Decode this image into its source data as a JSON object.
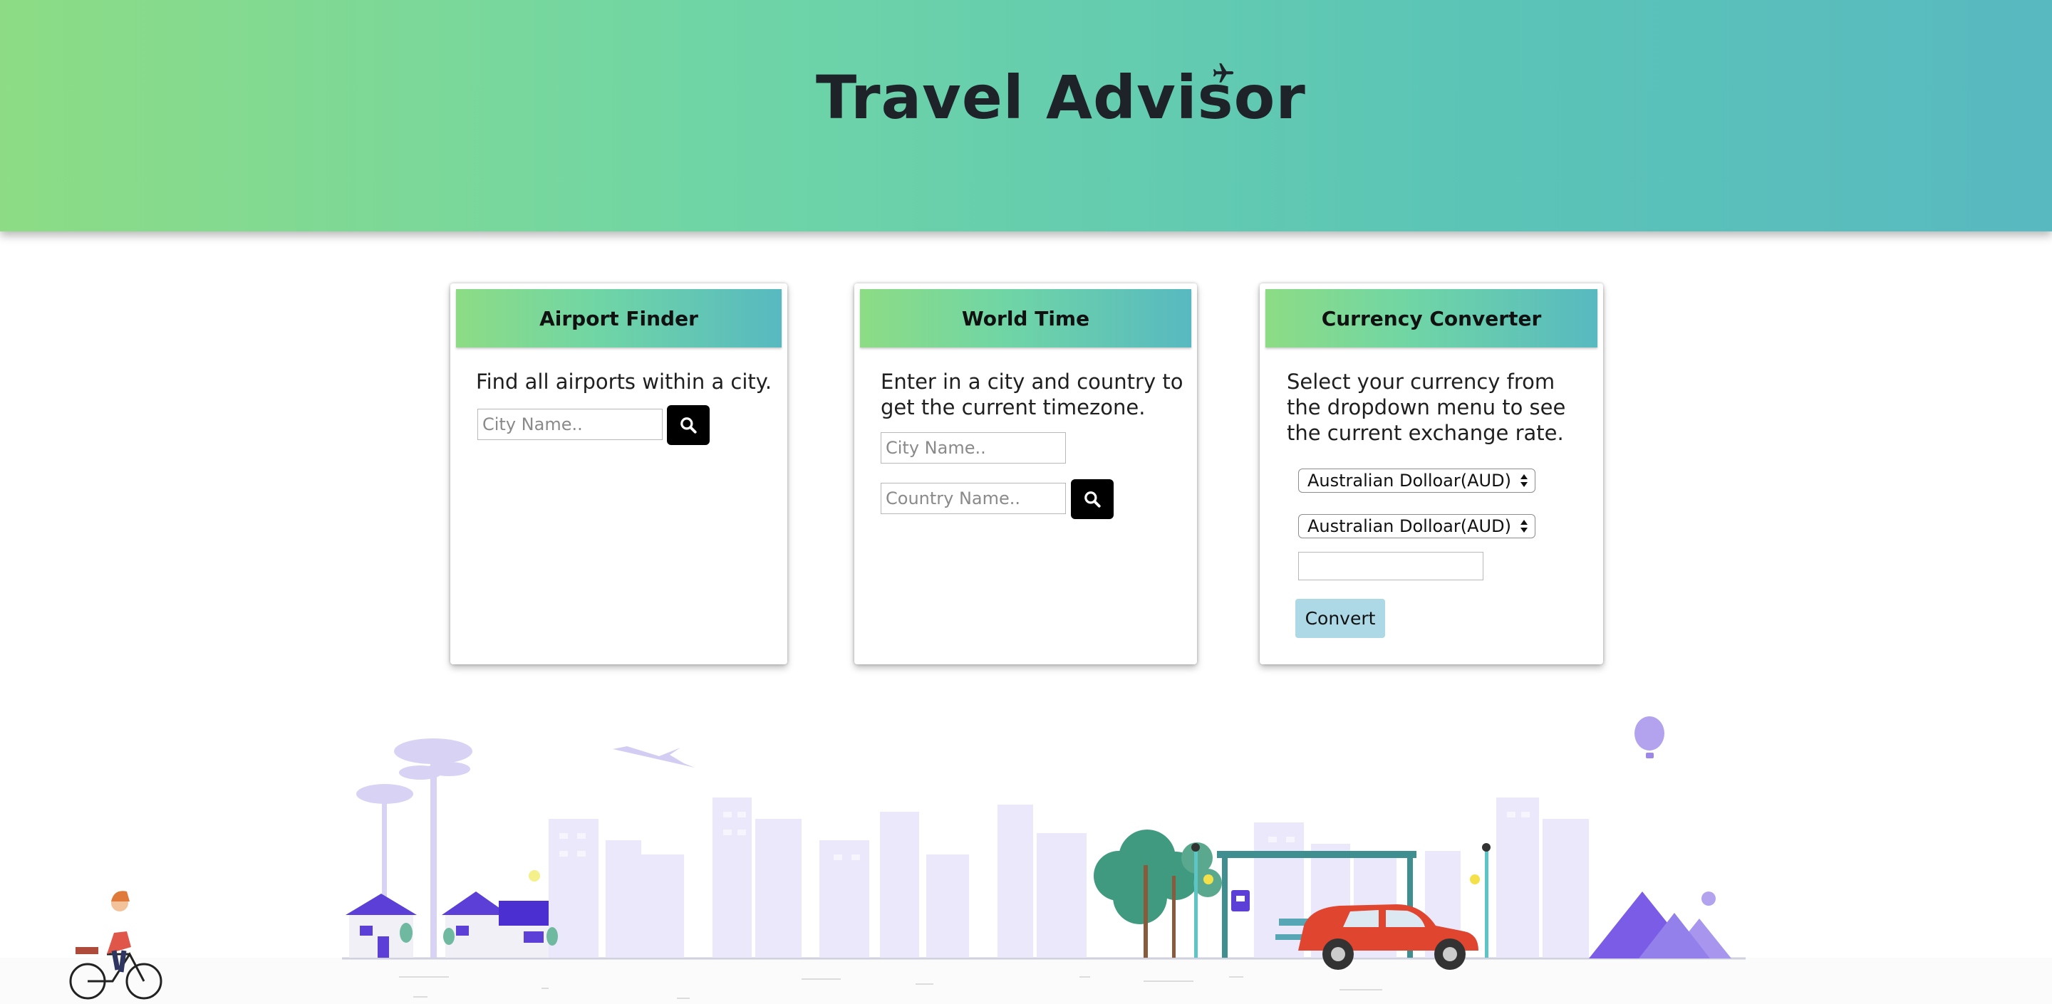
{
  "header": {
    "title": "Travel Advisor"
  },
  "airport_finder": {
    "heading": "Airport Finder",
    "description": "Find all airports within a city.",
    "city_placeholder": "City Name.."
  },
  "world_time": {
    "heading": "World Time",
    "description_line1": "Enter in a city and country to",
    "description_line2": "get the current timezone.",
    "city_placeholder": "City Name..",
    "country_placeholder": "Country Name.."
  },
  "currency_converter": {
    "heading": "Currency Converter",
    "description_line1": "Select your currency from",
    "description_line2": "the dropdown menu to see",
    "description_line3": "the current exchange rate.",
    "from_currency": "Australian Dolloar(AUD)",
    "to_currency": "Australian Dolloar(AUD)",
    "amount": "",
    "convert_label": "Convert"
  },
  "colors": {
    "header_gradient_start": "#8ddc85",
    "header_gradient_end": "#58b9c0",
    "convert_button": "#add8e6",
    "search_button": "#000000",
    "city_silhouette": "#ece8fb",
    "car": "#e0452f"
  },
  "icons": [
    "airplane-icon",
    "search-icon",
    "select-arrows-icon"
  ]
}
